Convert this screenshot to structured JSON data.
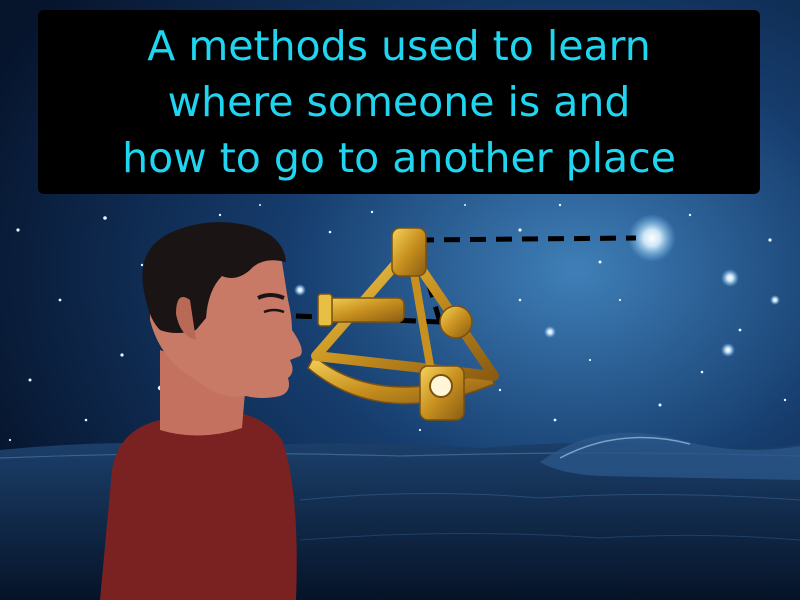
{
  "caption": {
    "text": "A methods used to learn\nwhere someone is and\nhow to go to another place"
  },
  "colors": {
    "caption_text": "#1fd5f0",
    "caption_bg": "#000000",
    "sky_top": "#0a1c3d",
    "sky_glow": "#3f7fb8",
    "sea": "#0a1f3e",
    "skin": "#c97a66",
    "hair": "#1a1414",
    "shirt": "#7a2222",
    "brass": "#d9a82e",
    "sight_line": "#000000"
  },
  "scene": {
    "objects": [
      "man-figure",
      "sextant",
      "bright-star",
      "sight-line",
      "ocean-waves",
      "starry-sky"
    ]
  }
}
